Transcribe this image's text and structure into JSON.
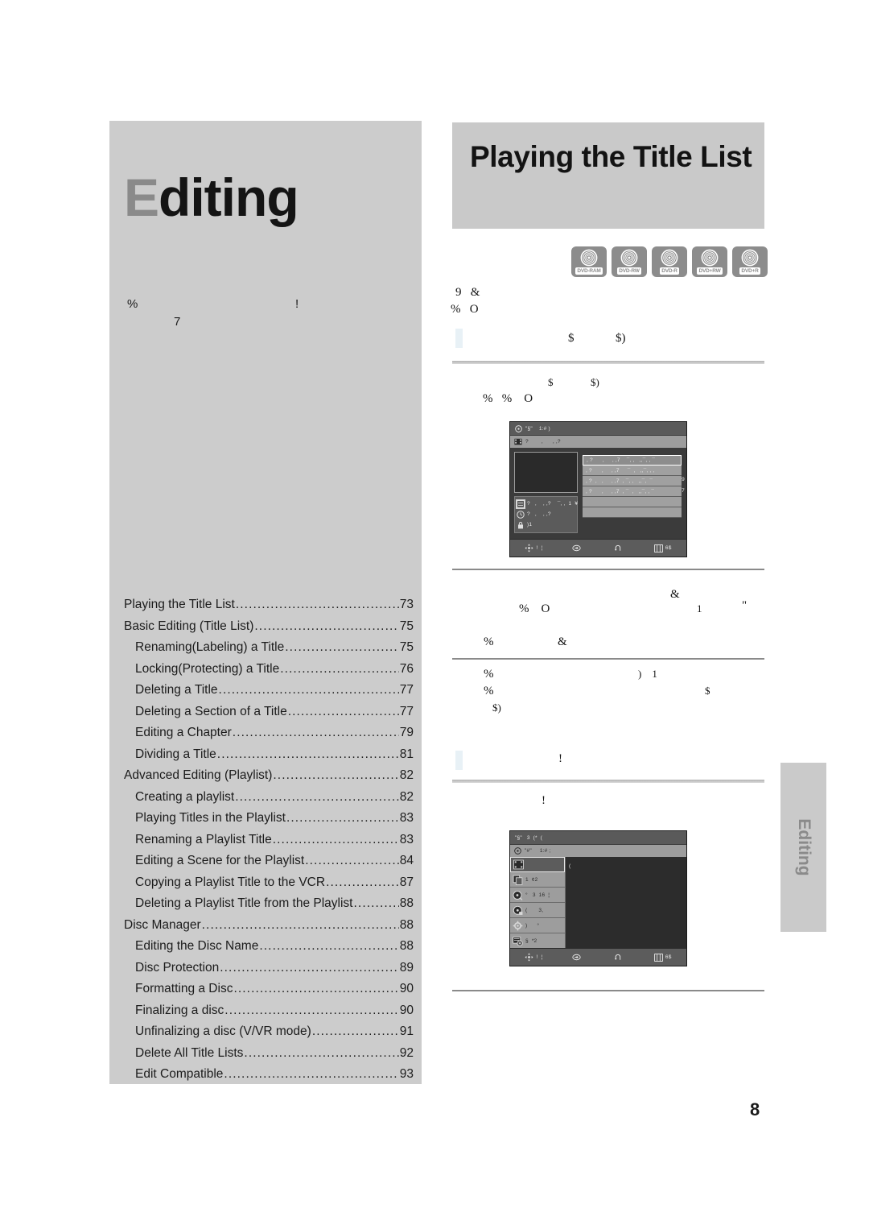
{
  "left": {
    "chapter_cap": "E",
    "chapter_rest": "diting",
    "intro": {
      "a": "%",
      "b": "!",
      "c": "7"
    },
    "toc": [
      {
        "label": "Playing the Title List",
        "page": "73",
        "level": 1
      },
      {
        "label": "Basic Editing (Title List)",
        "page": "75",
        "level": 1
      },
      {
        "label": "Renaming(Labeling) a Title",
        "page": "75",
        "level": 2
      },
      {
        "label": "Locking(Protecting) a Title",
        "page": "76",
        "level": 2
      },
      {
        "label": "Deleting a Title",
        "page": "77",
        "level": 2
      },
      {
        "label": "Deleting a Section of a Title",
        "page": "77",
        "level": 2
      },
      {
        "label": "Editing a Chapter",
        "page": "79",
        "level": 2
      },
      {
        "label": "Dividing a Title",
        "page": "81",
        "level": 2
      },
      {
        "label": "Advanced Editing (Playlist)",
        "page": "82",
        "level": 1
      },
      {
        "label": "Creating a playlist",
        "page": "82",
        "level": 2
      },
      {
        "label": "Playing Titles in the Playlist",
        "page": "83",
        "level": 2
      },
      {
        "label": "Renaming a Playlist Title",
        "page": "83",
        "level": 2
      },
      {
        "label": "Editing a Scene for the Playlist",
        "page": "84",
        "level": 2
      },
      {
        "label": "Copying a Playlist Title to the VCR",
        "page": "87",
        "level": 2
      },
      {
        "label": "Deleting a Playlist Title from the Playlist",
        "page": "88",
        "level": 2
      },
      {
        "label": "Disc Manager",
        "page": "88",
        "level": 1
      },
      {
        "label": "Editing the Disc Name",
        "page": "88",
        "level": 2
      },
      {
        "label": "Disc Protection",
        "page": "89",
        "level": 2
      },
      {
        "label": "Formatting a Disc",
        "page": "90",
        "level": 2
      },
      {
        "label": "Finalizing a disc",
        "page": "90",
        "level": 2
      },
      {
        "label": "Unfinalizing a disc (V/VR mode)",
        "page": "91",
        "level": 2
      },
      {
        "label": "Delete All Title Lists",
        "page": "92",
        "level": 2
      },
      {
        "label": "Edit Compatible",
        "page": "93",
        "level": 2
      }
    ]
  },
  "right": {
    "heading": "Playing the Title List",
    "disc_badges": [
      {
        "label": "DVD-RAM"
      },
      {
        "label": "DVD-RW"
      },
      {
        "label": "DVD-R"
      },
      {
        "label": "DVD+RW"
      },
      {
        "label": "DVD+R"
      }
    ],
    "body": {
      "l1": "9   &",
      "l2": "%   O",
      "sub1_a": "$",
      "sub1_b": "$)",
      "l3_a": "$",
      "l3_b": "$)",
      "l4": "%   %    O",
      "l5": "&",
      "l6": "%    O",
      "l7": "1",
      "l8": "\"",
      "l9": "%",
      "l10": "&",
      "l11": "%",
      "l12": ")    1",
      "l13": "%",
      "l14": "$",
      "l15": "$)",
      "sub2": "!",
      "l16": "!"
    },
    "osd1": {
      "topbar": "\"§\"    1:# )",
      "subbar": "?        ,      , ,?",
      "rows": [
        ", ?      ,     , ,7    ¯, ,   ,,¯, , ¯",
        ", ?      ,     , ,7     ¯  ,   ,,¯, , ,",
        ", ?  ,   ,     , ,7  , ¯, ,   ,,¯,  ¯",
        ", ?      ,     , ,7  , ¯  ,   ,,¯, , ¯",
        "",
        ""
      ],
      "side_marks": {
        "a": "9",
        "b": "7"
      },
      "info": [
        "?   ,    , ,?    ¯, ,  1  ¥",
        "?   ,    , ,?",
        ")1"
      ],
      "bottom": [
        "!  ¦",
        "",
        "",
        "6$"
      ]
    },
    "osd2": {
      "topbar": "\"§\"   3  (*  (",
      "subbar": "\"#\"     1:# ;",
      "menu": [
        "",
        "1  ¢2",
        "°   3  16  ¦",
        "(       3,",
        ")      °",
        "§  *2"
      ],
      "pane": "(",
      "bottom": [
        "!  ¦",
        "",
        "",
        "6$"
      ]
    }
  },
  "side_tab": {
    "label": "Editing"
  },
  "page_number": "8",
  "colors": {
    "panel_gray": "#cccccc",
    "band_gray": "#c9c9c9",
    "badge_gray": "#8c8c8c",
    "osd_dark": "#3b3b3b",
    "marker_blue": "#e8f1f6"
  }
}
